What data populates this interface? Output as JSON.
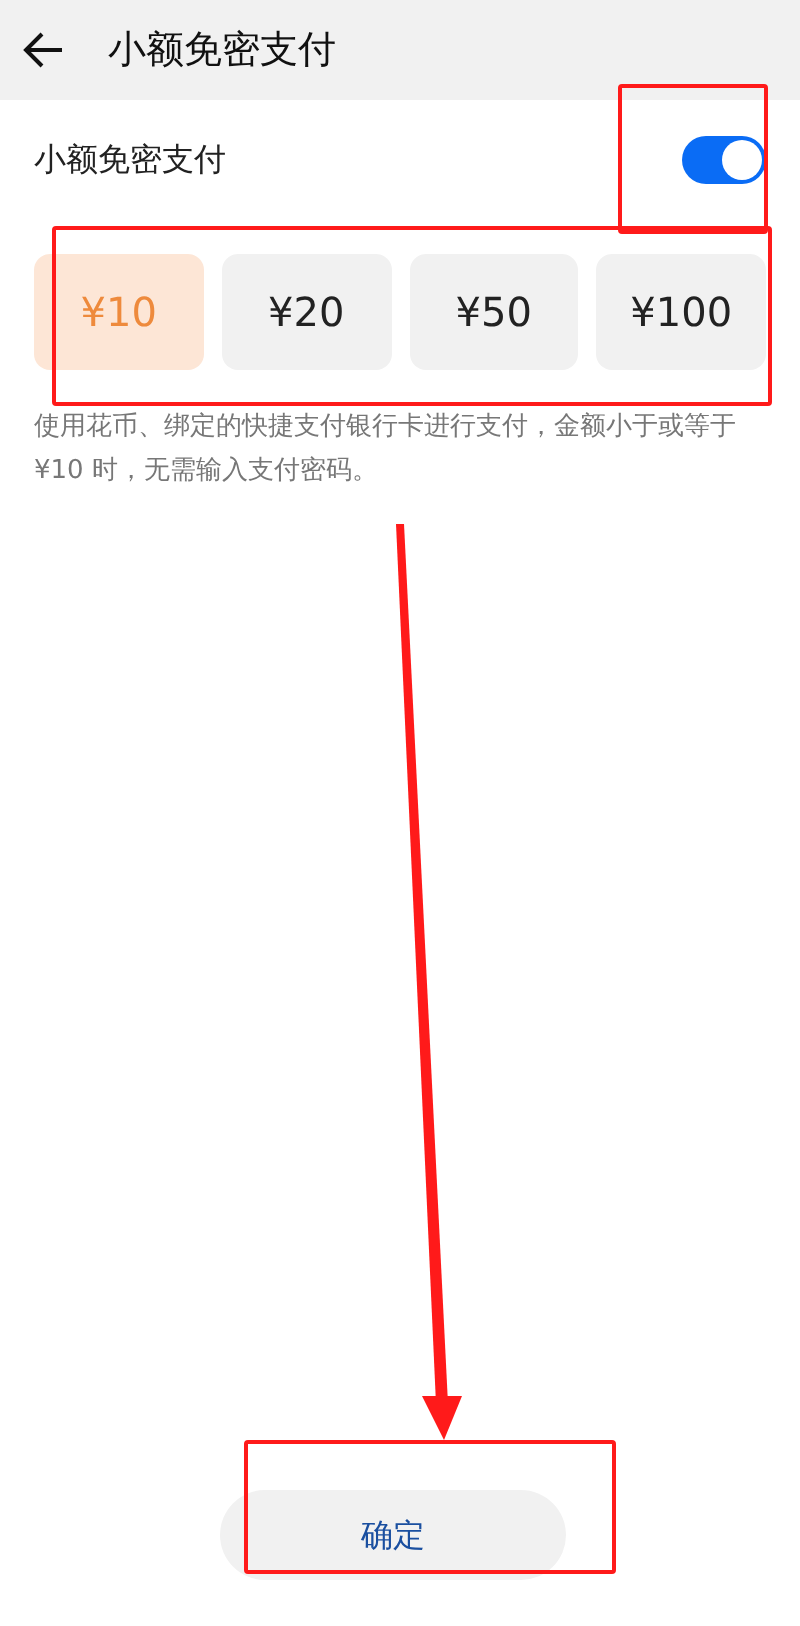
{
  "header": {
    "title": "小额免密支付"
  },
  "setting": {
    "label": "小额免密支付",
    "on": true
  },
  "amounts": [
    {
      "label": "¥10",
      "selected": true
    },
    {
      "label": "¥20",
      "selected": false
    },
    {
      "label": "¥50",
      "selected": false
    },
    {
      "label": "¥100",
      "selected": false
    }
  ],
  "description": "使用花币、绑定的快捷支付银行卡进行支付，金额小于或等于 ¥10 时，无需输入支付密码。",
  "confirm_button": "确定"
}
